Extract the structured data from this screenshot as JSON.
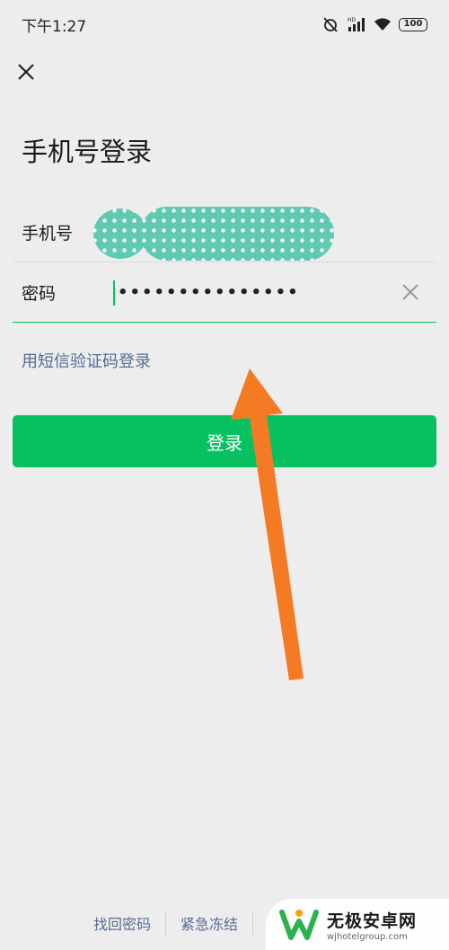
{
  "status": {
    "time": "下午1:27",
    "battery": "100"
  },
  "page": {
    "title": "手机号登录"
  },
  "form": {
    "phone_label": "手机号",
    "password_label": "密码",
    "password_mask": "•••••••••••••••"
  },
  "sms_login_link": "用短信验证码登录",
  "login_button": "登录",
  "footer": {
    "links": [
      "找回密码",
      "紧急冻结"
    ]
  },
  "watermark": {
    "title": "无极安卓网",
    "url": "wjhotelgroup.com"
  },
  "colors": {
    "accent": "#07c160",
    "link": "#576b95",
    "arrow": "#f47a24",
    "background": "#ededed"
  }
}
